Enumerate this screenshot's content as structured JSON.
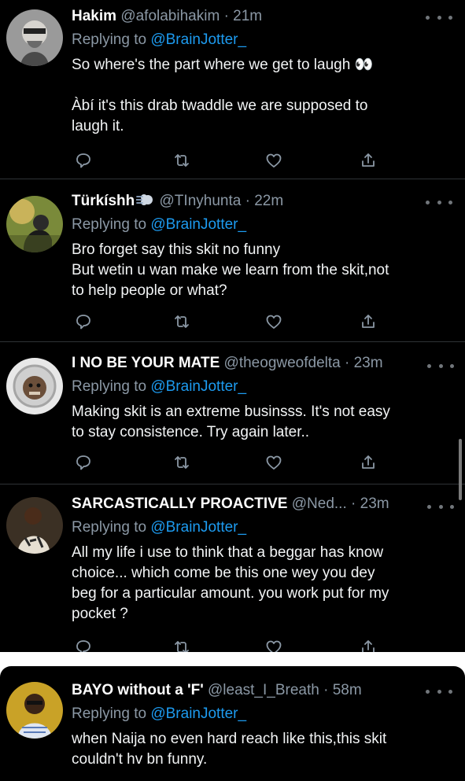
{
  "tweets": [
    {
      "name": "Hakim",
      "handle": "@afolabihakim",
      "sep": "·",
      "time": "21m",
      "replying_prefix": "Replying to ",
      "replying_to": "@BrainJotter_",
      "lines": [
        "So where's the part where we get to laugh 👀",
        "",
        "Àbí it's this drab twaddle we are supposed to",
        "laugh it."
      ]
    },
    {
      "name": "Türkíshh",
      "handle": "@TInyhunta",
      "sep": "·",
      "time": "22m",
      "replying_prefix": "Replying to ",
      "replying_to": "@BrainJotter_",
      "lines": [
        "Bro forget say this skit no funny",
        "But wetin u wan make we learn from the skit,not",
        "to help people or what?"
      ]
    },
    {
      "name": "I NO BE YOUR MATE",
      "handle": "@theogweofdelta",
      "sep": "·",
      "time": "23m",
      "replying_prefix": "Replying to ",
      "replying_to": "@BrainJotter_",
      "lines": [
        "Making skit is an extreme businsss. It's not easy",
        "to stay consistence. Try again later.."
      ]
    },
    {
      "name": "SARCASTICALLY PROACTIVE",
      "handle": "@Ned...",
      "sep": "·",
      "time": "23m",
      "replying_prefix": "Replying to ",
      "replying_to": "@BrainJotter_",
      "lines": [
        "All my life i use to think that a beggar has know",
        "choice... which come be this one wey you dey",
        "beg for a particular amount. you work put for my",
        "pocket ?"
      ]
    },
    {
      "name": "BAYO without a 'F'",
      "handle": "@least_I_Breath",
      "sep": "·",
      "time": "58m",
      "replying_prefix": "Replying to ",
      "replying_to": "@BrainJotter_",
      "lines": [
        "when Naija no even hard reach like this,this skit",
        "couldn't hv bn funny."
      ]
    }
  ],
  "icons": {
    "reply": "reply-icon",
    "retweet": "retweet-icon",
    "like": "heart-icon",
    "share": "share-icon",
    "more": "more-icon",
    "badge": "dash-emoji-icon"
  },
  "colors": {
    "background": "#000000",
    "text": "#e7e9ea",
    "muted": "#8b98a5",
    "mention": "#1d9bf0",
    "divider": "#2f3336"
  }
}
